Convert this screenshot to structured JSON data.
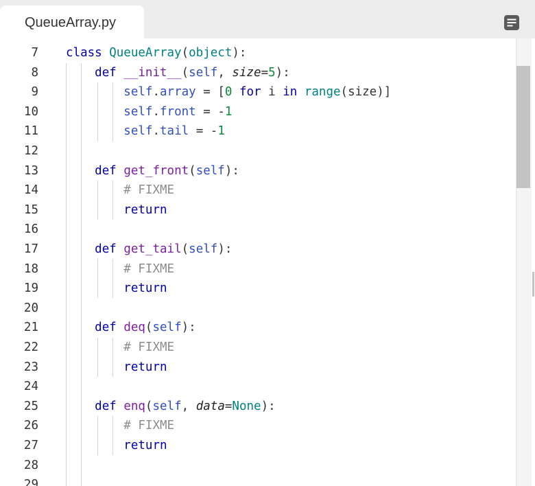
{
  "tab": {
    "title": "QueueArray.py"
  },
  "toolbar": {
    "menu_icon": "document-lines-icon"
  },
  "editor": {
    "line_numbers": [
      "7",
      "8",
      "9",
      "10",
      "11",
      "12",
      "13",
      "14",
      "15",
      "16",
      "17",
      "18",
      "19",
      "20",
      "21",
      "22",
      "23",
      "24",
      "25",
      "26",
      "27",
      "28",
      "29"
    ],
    "lines": [
      "class QueueArray(object):",
      "    def __init__(self, size=5):",
      "        self.array = [0 for i in range(size)]",
      "        self.front = -1",
      "        self.tail = -1",
      "",
      "    def get_front(self):",
      "        # FIXME",
      "        return",
      "",
      "    def get_tail(self):",
      "        # FIXME",
      "        return",
      "",
      "    def deq(self):",
      "        # FIXME",
      "        return",
      "",
      "    def enq(self, data=None):",
      "        # FIXME",
      "        return",
      "",
      ""
    ]
  },
  "colors": {
    "keyword": "#0000aa",
    "class_name": "#008080",
    "function_name": "#7a1fa2",
    "self": "#2f4fbf",
    "number": "#0a8a3b",
    "comment": "#8c8c8c"
  }
}
